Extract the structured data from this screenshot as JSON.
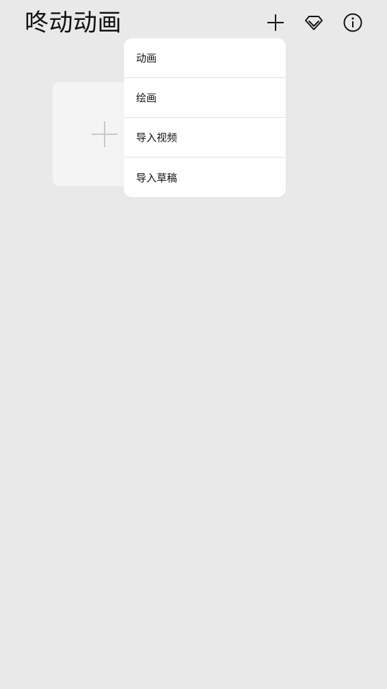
{
  "header": {
    "title": "咚动动画",
    "add_icon": "plus-icon",
    "premium_icon": "diamond-icon",
    "info_icon": "info-icon"
  },
  "main": {
    "new_card_icon": "plus-icon"
  },
  "dropdown": {
    "items": [
      {
        "label": "动画"
      },
      {
        "label": "绘画"
      },
      {
        "label": "导入视频"
      },
      {
        "label": "导入草稿"
      }
    ]
  },
  "colors": {
    "background": "#e9e9e9",
    "card": "#f4f4f4",
    "menu": "#ffffff",
    "text": "#111111",
    "divider": "#e2e2e2",
    "plus_light": "#c8c8c8"
  }
}
